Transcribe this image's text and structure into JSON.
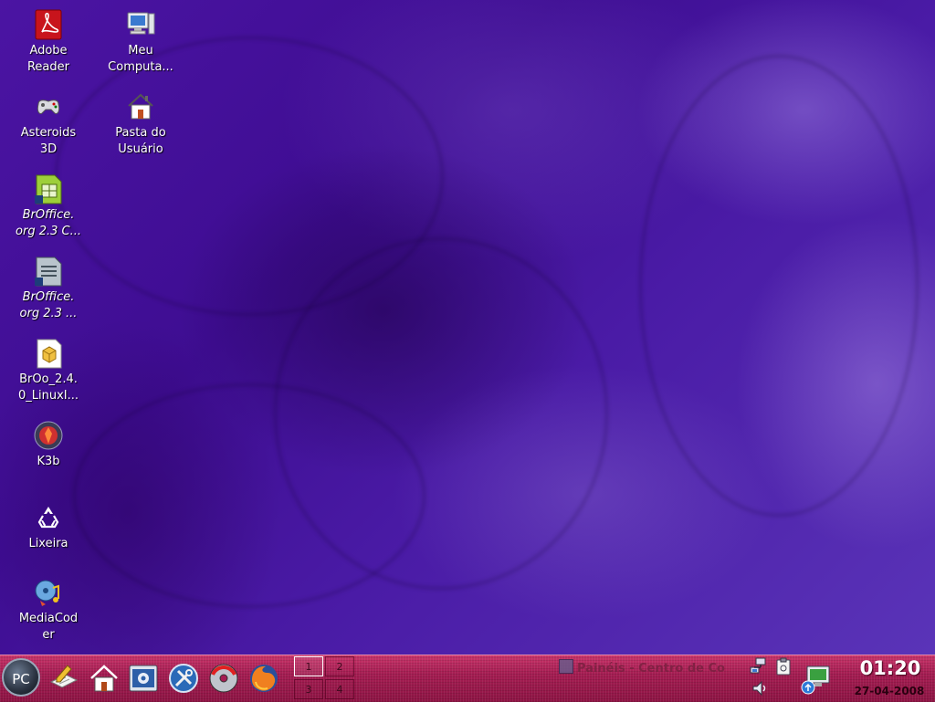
{
  "desktop": {
    "icons": [
      {
        "name": "adobe-reader",
        "label": "Adobe\nReader",
        "icon": "pdf-icon",
        "italic": false
      },
      {
        "name": "asteroids-3d",
        "label": "Asteroids\n3D",
        "icon": "gamepad-icon",
        "italic": false
      },
      {
        "name": "broffice-calc",
        "label": "BrOffice.\norg 2.3 C...",
        "icon": "spreadsheet-icon",
        "italic": true
      },
      {
        "name": "broffice-writer",
        "label": "BrOffice.\norg 2.3 ...",
        "icon": "document-icon",
        "italic": true
      },
      {
        "name": "broo-package",
        "label": "BrOo_2.4.\n0_LinuxI...",
        "icon": "package-icon",
        "italic": false
      },
      {
        "name": "k3b",
        "label": "K3b",
        "icon": "k3b-icon",
        "italic": false
      },
      {
        "name": "lixeira",
        "label": "Lixeira",
        "icon": "trash-icon",
        "italic": false
      },
      {
        "name": "mediacoder",
        "label": "MediaCod\ner",
        "icon": "media-icon",
        "italic": false
      },
      {
        "name": "meu-computador",
        "label": "Meu\nComputa...",
        "icon": "computer-icon",
        "italic": false
      },
      {
        "name": "pasta-do-usuario",
        "label": "Pasta do\nUsuário",
        "icon": "home-folder-icon",
        "italic": false
      }
    ]
  },
  "taskbar": {
    "menu_button_label": "PC",
    "quick_launch": [
      {
        "name": "text-editor",
        "icon": "notepad-pencil-icon"
      },
      {
        "name": "home",
        "icon": "home-icon"
      },
      {
        "name": "control-center",
        "icon": "control-center-icon"
      },
      {
        "name": "system-tools",
        "icon": "tools-icon"
      },
      {
        "name": "cd-burner",
        "icon": "cd-icon"
      },
      {
        "name": "firefox",
        "icon": "firefox-icon"
      }
    ],
    "pager": {
      "desktops": [
        "1",
        "2",
        "3",
        "4"
      ],
      "active": 1
    },
    "task_label": "Painéis - Centro de Co",
    "clock": {
      "time": "01:20",
      "date": "27-04-2008"
    }
  },
  "colors": {
    "desktop_base": "#4b14a3",
    "taskbar_base": "#a51d52",
    "clock_text": "#ffffff"
  }
}
